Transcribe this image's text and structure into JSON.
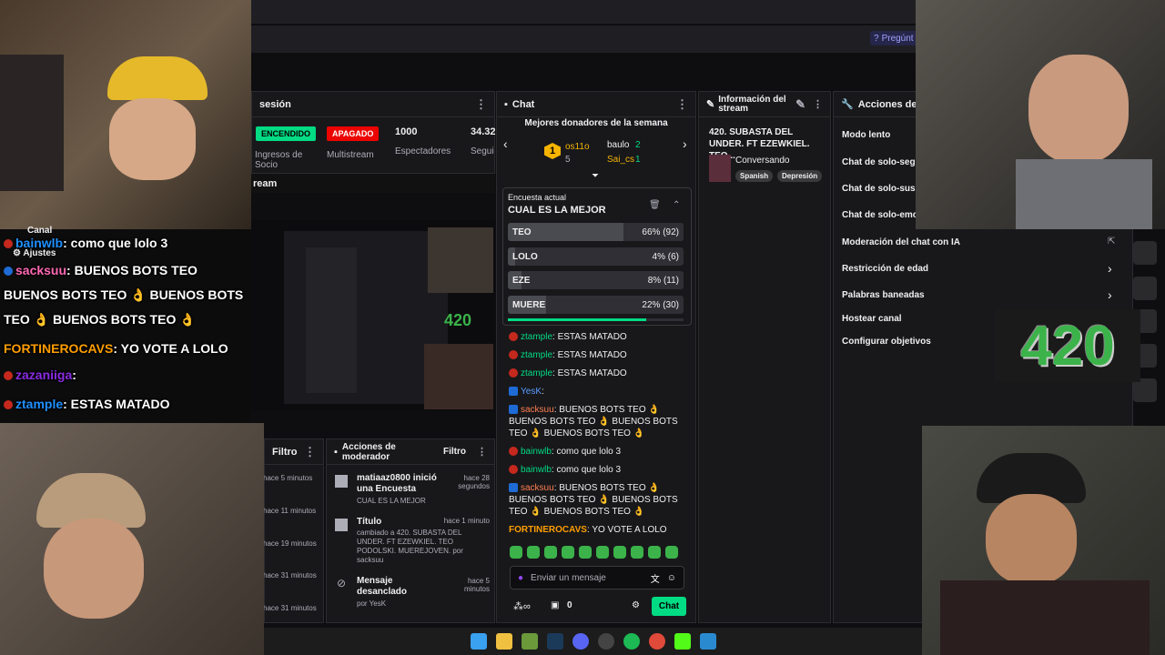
{
  "topbar": {
    "help_label": "Pregúnt"
  },
  "session": {
    "title": "sesión",
    "status_on": "ENCENDIDO",
    "status_off": "APAGADO",
    "revenue_label": "Ingresos de Socio",
    "multistream_label": "Multistream",
    "viewers_value": "1000",
    "viewers_label": "Espectadores",
    "followers_value": "34.32",
    "followers_label": "Segui",
    "stream_label": "ream"
  },
  "chat": {
    "title": "Chat",
    "donors_title": "Mejores donadores de la semana",
    "donor1_name": "os11o",
    "donor1_count": "5",
    "donor2_name": "baulo",
    "donor2_count": "2",
    "donor3_name": "Sai_cs",
    "donor3_count": "1",
    "poll_header": "Encuesta actual",
    "poll_title": "CUAL ES LA MEJOR",
    "poll_options": [
      {
        "label": "TEO",
        "result": "66% (92)",
        "pct": 66
      },
      {
        "label": "LOLO",
        "result": "4% (6)",
        "pct": 4
      },
      {
        "label": "EZE",
        "result": "8% (11)",
        "pct": 8
      },
      {
        "label": "MUERE",
        "result": "22% (30)",
        "pct": 22
      }
    ],
    "messages": [
      {
        "user": "ztample",
        "text": ": ESTAS MATADO"
      },
      {
        "user": "ztample",
        "text": ": ESTAS MATADO"
      },
      {
        "user": "ztample",
        "text": ": ESTAS MATADO"
      },
      {
        "user": "YesK",
        "text": ":"
      },
      {
        "user": "sacksuu",
        "text": ": BUENOS BOTS TEO 👌 BUENOS BOTS TEO 👌 BUENOS BOTS TEO 👌 BUENOS BOTS TEO 👌"
      },
      {
        "user": "bainwlb",
        "text": ": como que lolo 3"
      },
      {
        "user": "bainwlb",
        "text": ": como que lolo 3"
      },
      {
        "user": "sacksuu",
        "text": ": BUENOS BOTS TEO 👌 BUENOS BOTS TEO 👌 BUENOS BOTS TEO 👌 BUENOS BOTS TEO 👌"
      },
      {
        "user": "FORTINEROCAVS",
        "text": ": YO VOTE A LOLO"
      }
    ],
    "input_placeholder": "Enviar un mensaje",
    "points_value": "0",
    "send_label": "Chat"
  },
  "stream_info": {
    "title": "Información del stream",
    "stream_title": "420. SUBASTA DEL UNDER. FT EZEWKIEL. TEO...",
    "category": "Conversando",
    "tag1": "Spanish",
    "tag2": "Depresión"
  },
  "actions": {
    "title": "Acciones de ca",
    "items": [
      "Modo lento",
      "Chat de solo-segu",
      "Chat de solo-susc",
      "Chat de solo-emo",
      "Moderación del chat con IA",
      "Restricción de edad",
      "Palabras baneadas",
      "Hostear canal",
      "Configurar objetivos"
    ]
  },
  "moderator": {
    "title": "Acciones de moderador",
    "filter_label": "Filtro",
    "filter_label_left": "Filtro",
    "items": [
      {
        "title": "matiaaz0800 inició una Encuesta",
        "sub": "CUAL ES LA MEJOR",
        "time": "hace 28 segundos"
      },
      {
        "title": "Título",
        "sub": "cambiado a 420. SUBASTA DEL UNDER. FT EZEWKIEL. TEO PODOLSKI. MUEREJOVEN. por sacksuu",
        "time": "hace 1 minuto"
      },
      {
        "title": "Mensaje desanclado",
        "sub": "por YesK",
        "time": "hace 5 minutos"
      }
    ],
    "left_times": [
      "hace 5 minutos",
      "hace 11 minutos",
      "hace 19 minutos",
      "hace 31 minutos",
      "hace 31 minutos"
    ]
  },
  "overlay_chat": {
    "channel": "Canal",
    "settings": "Ajustes",
    "lines": [
      {
        "user": "bainwlb",
        "text": ": como que lolo 3",
        "color": "#1e90ff"
      },
      {
        "user": "sacksuu",
        "text": ": BUENOS BOTS TEO",
        "color": "#ff69b4"
      },
      {
        "user": "",
        "text": "BUENOS BOTS TEO 👌 BUENOS BOTS",
        "color": ""
      },
      {
        "user": "",
        "text": "TEO 👌 BUENOS BOTS TEO 👌",
        "color": ""
      },
      {
        "user": "FORTINEROCAVS",
        "text": ": YO VOTE A LOLO",
        "color": "#ff9e00"
      },
      {
        "user": "zazaniiga",
        "text": ":",
        "color": "#8a2be2"
      },
      {
        "user": "ztample",
        "text": ": ESTAS MATADO",
        "color": "#1e90ff"
      }
    ]
  },
  "logo_text": "420",
  "colors": {
    "accent_green": "#00db84",
    "live_red": "#eb0400",
    "twitch_purple": "#9147ff"
  }
}
